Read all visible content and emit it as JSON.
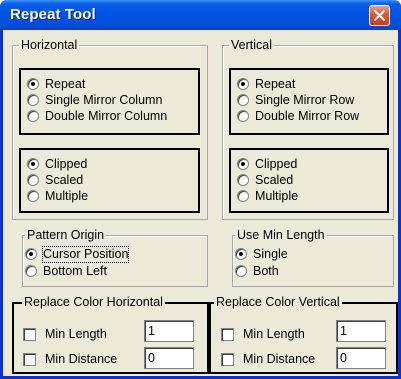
{
  "window": {
    "title": "Repeat Tool",
    "close_icon": "close-icon",
    "close_color": "#e2593a",
    "titlebar_color": "#0054e3"
  },
  "horizontal": {
    "label": "Horizontal",
    "mode_options": [
      {
        "label": "Repeat",
        "selected": true
      },
      {
        "label": "Single Mirror Column",
        "selected": false
      },
      {
        "label": "Double Mirror Column",
        "selected": false
      }
    ],
    "fit_options": [
      {
        "label": "Clipped",
        "selected": true
      },
      {
        "label": "Scaled",
        "selected": false
      },
      {
        "label": "Multiple",
        "selected": false
      }
    ]
  },
  "vertical": {
    "label": "Vertical",
    "mode_options": [
      {
        "label": "Repeat",
        "selected": true
      },
      {
        "label": "Single Mirror Row",
        "selected": false
      },
      {
        "label": "Double Mirror Row",
        "selected": false
      }
    ],
    "fit_options": [
      {
        "label": "Clipped",
        "selected": true
      },
      {
        "label": "Scaled",
        "selected": false
      },
      {
        "label": "Multiple",
        "selected": false
      }
    ]
  },
  "pattern_origin": {
    "label": "Pattern Origin",
    "options": [
      {
        "label": "Cursor Position",
        "selected": true
      },
      {
        "label": "Bottom Left",
        "selected": false
      }
    ]
  },
  "use_min_length": {
    "label": "Use Min Length",
    "options": [
      {
        "label": "Single",
        "selected": true
      },
      {
        "label": "Both",
        "selected": false
      }
    ]
  },
  "replace_color_horizontal": {
    "label": "Replace Color Horizontal",
    "min_length_label": "Min Length",
    "min_length_value": "1",
    "min_length_checked": false,
    "min_distance_label": "Min Distance",
    "min_distance_value": "0",
    "min_distance_checked": false
  },
  "replace_color_vertical": {
    "label": "Replace Color Vertical",
    "min_length_label": "Min Length",
    "min_length_value": "1",
    "min_length_checked": false,
    "min_distance_label": "Min Distance",
    "min_distance_value": "0",
    "min_distance_checked": false
  }
}
